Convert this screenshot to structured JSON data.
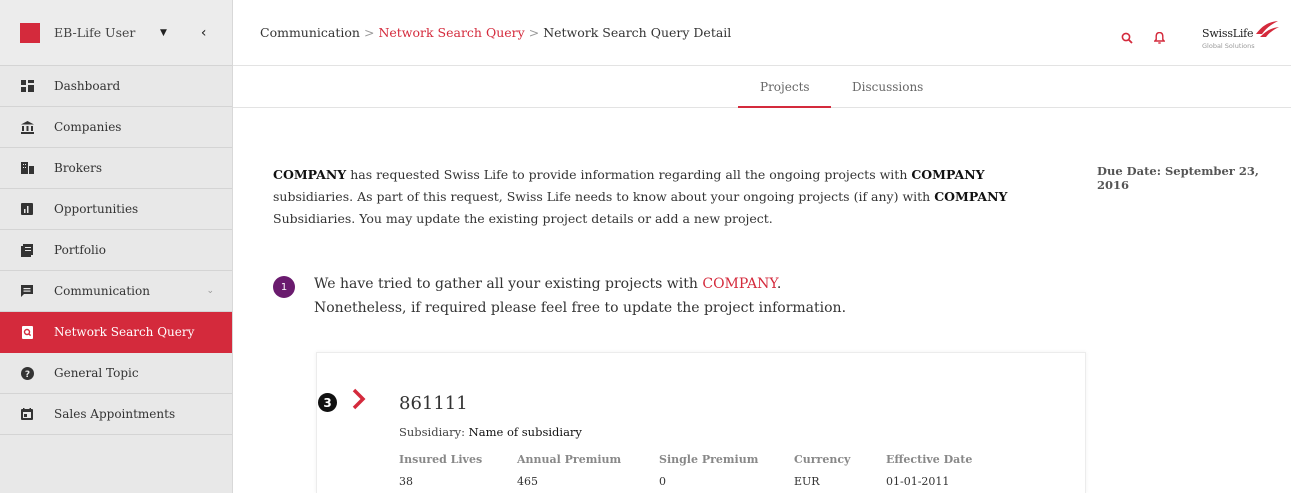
{
  "user": {
    "name": "EB-Life User"
  },
  "sidebar": {
    "items": [
      {
        "label": "Dashboard"
      },
      {
        "label": "Companies"
      },
      {
        "label": "Brokers"
      },
      {
        "label": "Opportunities"
      },
      {
        "label": "Portfolio"
      },
      {
        "label": "Communication"
      },
      {
        "label": "Network Search Query"
      },
      {
        "label": "General Topic"
      },
      {
        "label": "Sales Appointments"
      }
    ]
  },
  "breadcrumb": {
    "item1": "Communication",
    "item2": "Network Search Query",
    "item3": "Network Search Query Detail",
    "separator": ">"
  },
  "logo": {
    "name": "SwissLife",
    "sub": "Global Solutions"
  },
  "tabs": {
    "projects": "Projects",
    "discussions": "Discussions"
  },
  "intro": {
    "company1": "COMPANY",
    "p1": " has requested Swiss Life to provide information regarding all the ongoing projects with ",
    "company2": "COMPANY",
    "p2": " subsidiaries. As part of this request, Swiss Life needs to know about your ongoing projects (if any) with ",
    "company3": "COMPANY",
    "p3": " Subsidiaries. You may update the existing project details or add a new project."
  },
  "due_date": "Due Date: September 23, 2016",
  "step": {
    "number": "1",
    "line1_prefix": "We have tried to gather all your existing projects with ",
    "line1_company": "COMPANY",
    "line1_suffix": ".",
    "line2": "Nonetheless, if required please feel free to update the project information."
  },
  "project": {
    "badge": "3",
    "id": "861111",
    "subsidiary_label": "Subsidiary:",
    "subsidiary_value": "Name of subsidiary",
    "columns": [
      {
        "header": "Insured Lives",
        "value": "38"
      },
      {
        "header": "Annual Premium",
        "value": "465"
      },
      {
        "header": "Single Premium",
        "value": "0"
      },
      {
        "header": "Currency",
        "value": "EUR"
      },
      {
        "header": "Effective Date",
        "value": "01-01-2011"
      }
    ]
  },
  "colors": {
    "accent": "#d42a3c",
    "step": "#6a1b6e"
  }
}
